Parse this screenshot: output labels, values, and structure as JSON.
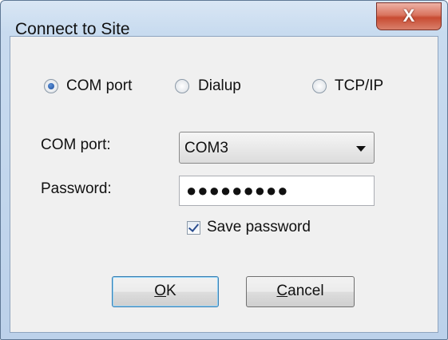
{
  "window": {
    "title": "Connect to Site",
    "close_glyph": "X"
  },
  "connection_types": [
    {
      "label": "COM port",
      "selected": true
    },
    {
      "label": "Dialup",
      "selected": false
    },
    {
      "label": "TCP/IP",
      "selected": false
    }
  ],
  "com_port": {
    "label": "COM port:",
    "value": "COM3"
  },
  "password": {
    "label": "Password:",
    "masked_value": "●●●●●●●●●"
  },
  "save_password": {
    "label": "Save password",
    "checked": true
  },
  "buttons": {
    "ok": {
      "accel": "O",
      "rest": "K"
    },
    "cancel": {
      "accel": "C",
      "rest": "ancel"
    }
  }
}
